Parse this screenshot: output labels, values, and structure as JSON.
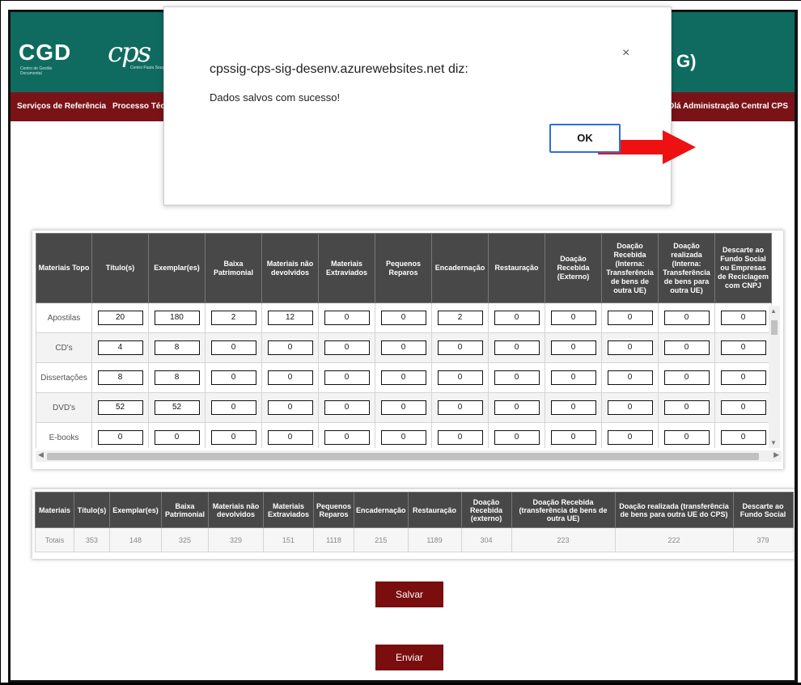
{
  "header": {
    "logo_cgd": "CGD",
    "logo_cgd_sub": "Centro de Gestão Documental",
    "logo_cps": "cps",
    "logo_cps_sub": "Centro Paula Souza",
    "title_tail": "G)"
  },
  "nav": {
    "items": [
      "Serviços de Referência",
      "Processo Técni"
    ],
    "greeting": "Olá Administração Central CPS"
  },
  "dialog": {
    "title": "cpssig-cps-sig-desenv.azurewebsites.net diz:",
    "message": "Dados salvos com sucesso!",
    "ok_label": "OK",
    "close_icon": "×"
  },
  "table1": {
    "headers": [
      "Materiais Topo",
      "Título(s)",
      "Exemplar(es)",
      "Baixa Patrimonial",
      "Materiais não devolvidos",
      "Materiais Extraviados",
      "Pequenos Reparos",
      "Encadernação",
      "Restauração",
      "Doação Recebida (Externo)",
      "Doação Recebida (Interna: Transferência de bens de outra UE)",
      "Doação realizada (Interna: Transferência de bens para outra UE)",
      "Descarte ao Fundo Social ou Empresas de Reciclagem com CNPJ"
    ],
    "rows": [
      {
        "label": "Apostilas",
        "values": [
          "20",
          "180",
          "2",
          "12",
          "0",
          "0",
          "2",
          "0",
          "0",
          "0",
          "0",
          "0"
        ]
      },
      {
        "label": "CD's",
        "values": [
          "4",
          "8",
          "0",
          "0",
          "0",
          "0",
          "0",
          "0",
          "0",
          "0",
          "0",
          "0"
        ]
      },
      {
        "label": "Dissertações",
        "values": [
          "8",
          "8",
          "0",
          "0",
          "0",
          "0",
          "0",
          "0",
          "0",
          "0",
          "0",
          "0"
        ]
      },
      {
        "label": "DVD's",
        "values": [
          "52",
          "52",
          "0",
          "0",
          "0",
          "0",
          "0",
          "0",
          "0",
          "0",
          "0",
          "0"
        ]
      },
      {
        "label": "E-books",
        "values": [
          "0",
          "0",
          "0",
          "0",
          "0",
          "0",
          "0",
          "0",
          "0",
          "0",
          "0",
          "0"
        ]
      }
    ]
  },
  "table2": {
    "headers": [
      "Materiais",
      "Título(s)",
      "Exemplar(es)",
      "Baixa Patrimonial",
      "Materiais não devolvidos",
      "Materiais Extraviados",
      "Pequenos Reparos",
      "Encadernação",
      "Restauração",
      "Doação Recebida (externo)",
      "Doação Recebida (transferência de bens de outra UE)",
      "Doação realizada (transferência de bens para outra UE do CPS)",
      "Descarte ao Fundo Social"
    ],
    "totals": [
      "Totais",
      "353",
      "148",
      "325",
      "329",
      "151",
      "1118",
      "215",
      "1189",
      "304",
      "223",
      "222",
      "379"
    ]
  },
  "buttons": {
    "save": "Salvar",
    "send": "Enviar"
  }
}
